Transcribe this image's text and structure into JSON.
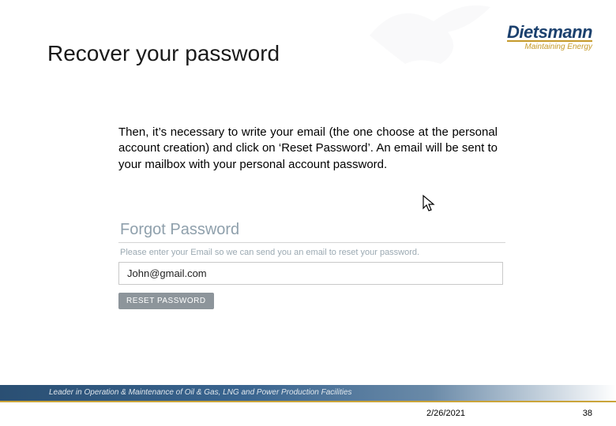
{
  "title": "Recover your password",
  "logo": {
    "brand": "Dietsmann",
    "tagline": "Maintaining Energy"
  },
  "instruction": "Then, it’s necessary to write your email (the one choose at the personal account creation) and click on ‘Reset Password’. An email will be sent to your mailbox with your personal account password.",
  "forgot": {
    "title": "Forgot Password",
    "message": "Please enter your Email so we can send you an email to reset your password.",
    "email_value": "John@gmail.com",
    "button": "RESET PASSWORD"
  },
  "footer": {
    "tagline": "Leader in Operation & Maintenance of Oil & Gas, LNG and Power Production Facilities"
  },
  "date": "2/26/2021",
  "page": "38"
}
